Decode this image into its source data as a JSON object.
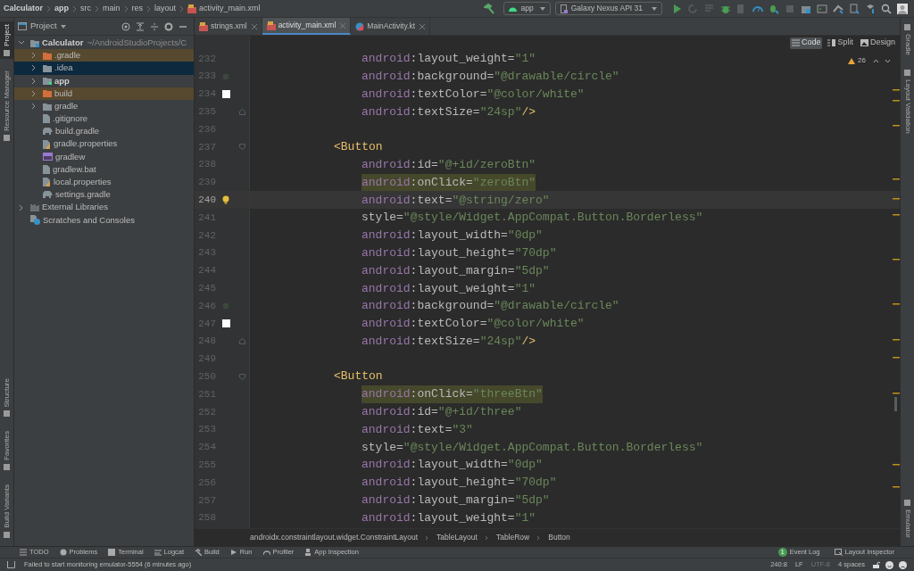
{
  "breadcrumb": [
    {
      "label": "Calculator",
      "bold": true
    },
    {
      "label": "app",
      "bold": true
    },
    {
      "label": "src",
      "bold": false
    },
    {
      "label": "main",
      "bold": false
    },
    {
      "label": "res",
      "bold": false
    },
    {
      "label": "layout",
      "bold": false
    },
    {
      "label": "activity_main.xml",
      "bold": false,
      "kind": "xml"
    }
  ],
  "run_config": {
    "module": "app",
    "device": "Galaxy Nexus API 31"
  },
  "left_stripe": {
    "top": [
      {
        "label": "Project",
        "selected": true
      },
      {
        "label": "Resource Manager",
        "selected": false
      }
    ],
    "bottom": [
      {
        "label": "Structure",
        "selected": false
      },
      {
        "label": "Favorites",
        "selected": false
      },
      {
        "label": "Build Variants",
        "selected": false
      }
    ]
  },
  "right_stripe": {
    "top": [
      {
        "label": "Gradle"
      },
      {
        "label": "Layout Validation"
      }
    ],
    "bottom": [
      {
        "label": "Emulator"
      }
    ]
  },
  "project_panel": {
    "title": "Project",
    "tree": [
      {
        "label": "Calculator",
        "path": "~/AndroidStudioProjects/C",
        "kind": "module-root",
        "expanded": true,
        "selected": false,
        "excluded": false,
        "bold": true,
        "children": [
          {
            "label": ".gradle",
            "kind": "folder",
            "expanded": false,
            "selected": false,
            "excluded": true,
            "bold": false
          },
          {
            "label": ".idea",
            "kind": "folder",
            "expanded": false,
            "selected": true,
            "excluded": false,
            "bold": false
          },
          {
            "label": "app",
            "kind": "module",
            "expanded": false,
            "selected": false,
            "excluded": false,
            "bold": true
          },
          {
            "label": "build",
            "kind": "folder",
            "expanded": false,
            "selected": false,
            "excluded": true,
            "bold": false
          },
          {
            "label": "gradle",
            "kind": "folder",
            "expanded": false,
            "selected": false,
            "excluded": false,
            "bold": false
          },
          {
            "label": ".gitignore",
            "kind": "file",
            "selected": false,
            "excluded": false,
            "bold": false
          },
          {
            "label": "build.gradle",
            "kind": "gradle",
            "selected": false,
            "excluded": false,
            "bold": false
          },
          {
            "label": "gradle.properties",
            "kind": "properties",
            "selected": false,
            "excluded": false,
            "bold": false
          },
          {
            "label": "gradlew",
            "kind": "script",
            "selected": false,
            "excluded": false,
            "bold": false
          },
          {
            "label": "gradlew.bat",
            "kind": "file",
            "selected": false,
            "excluded": false,
            "bold": false
          },
          {
            "label": "local.properties",
            "kind": "properties",
            "selected": false,
            "excluded": false,
            "bold": false
          },
          {
            "label": "settings.gradle",
            "kind": "gradle",
            "selected": false,
            "excluded": false,
            "bold": false
          }
        ]
      },
      {
        "label": "External Libraries",
        "kind": "library",
        "expanded": false,
        "selected": false,
        "excluded": false,
        "bold": false
      },
      {
        "label": "Scratches and Consoles",
        "kind": "scratches",
        "selected": false,
        "excluded": false,
        "bold": false
      }
    ]
  },
  "tabs": [
    {
      "label": "strings.xml",
      "kind": "xml",
      "selected": false
    },
    {
      "label": "activity_main.xml",
      "kind": "xml",
      "selected": true
    },
    {
      "label": "MainActivity.kt",
      "kind": "kotlin",
      "selected": false
    }
  ],
  "view_modes": [
    {
      "label": "Code",
      "kind": "code",
      "selected": true
    },
    {
      "label": "Split",
      "kind": "split",
      "selected": false
    },
    {
      "label": "Design",
      "kind": "design",
      "selected": false
    }
  ],
  "warnings": "26",
  "code_lines": [
    {
      "number": "232",
      "kind": "attribute",
      "text": "android:layout_weight=\"1\"",
      "current": false,
      "highlighted": false
    },
    {
      "number": "233",
      "kind": "attribute",
      "text": "android:background=\"@drawable/circle\"",
      "current": false,
      "highlighted": false,
      "gutter": {
        "kind": "drawable"
      }
    },
    {
      "number": "234",
      "kind": "attribute",
      "text": "android:textColor=\"@color/white\"",
      "current": false,
      "highlighted": false,
      "gutter": {
        "kind": "color"
      }
    },
    {
      "number": "235",
      "kind": "attribute",
      "text": "android:textSize=\"24sp\"/>",
      "current": false,
      "highlighted": false,
      "fold": {
        "kind": "end"
      }
    },
    {
      "number": "236",
      "kind": "blank",
      "current": false,
      "highlighted": false
    },
    {
      "number": "237",
      "kind": "tag",
      "text": "<Button",
      "current": false,
      "highlighted": false,
      "fold": {
        "kind": "start"
      }
    },
    {
      "number": "238",
      "kind": "attribute",
      "text": "android:id=\"@+id/zeroBtn\"",
      "current": false,
      "highlighted": false
    },
    {
      "number": "239",
      "kind": "attribute",
      "text": "android:onClick=\"zeroBtn\"",
      "current": false,
      "highlighted": true
    },
    {
      "number": "240",
      "kind": "attribute",
      "text": "android:text=\"@string/zero\"",
      "current": true,
      "highlighted": false,
      "gutter": {
        "kind": "bulb"
      }
    },
    {
      "number": "241",
      "kind": "attribute",
      "text": "style=\"@style/Widget.AppCompat.Button.Borderless\"",
      "current": false,
      "highlighted": false
    },
    {
      "number": "242",
      "kind": "attribute",
      "text": "android:layout_width=\"0dp\"",
      "current": false,
      "highlighted": false
    },
    {
      "number": "243",
      "kind": "attribute",
      "text": "android:layout_height=\"70dp\"",
      "current": false,
      "highlighted": false
    },
    {
      "number": "244",
      "kind": "attribute",
      "text": "android:layout_margin=\"5dp\"",
      "current": false,
      "highlighted": false
    },
    {
      "number": "245",
      "kind": "attribute",
      "text": "android:layout_weight=\"1\"",
      "current": false,
      "highlighted": false
    },
    {
      "number": "246",
      "kind": "attribute",
      "text": "android:background=\"@drawable/circle\"",
      "current": false,
      "highlighted": false,
      "gutter": {
        "kind": "drawable"
      }
    },
    {
      "number": "247",
      "kind": "attribute",
      "text": "android:textColor=\"@color/white\"",
      "current": false,
      "highlighted": false,
      "gutter": {
        "kind": "color"
      }
    },
    {
      "number": "248",
      "kind": "attribute",
      "text": "android:textSize=\"24sp\"/>",
      "current": false,
      "highlighted": false,
      "fold": {
        "kind": "end"
      }
    },
    {
      "number": "249",
      "kind": "blank",
      "current": false,
      "highlighted": false
    },
    {
      "number": "250",
      "kind": "tag",
      "text": "<Button",
      "current": false,
      "highlighted": false,
      "fold": {
        "kind": "start"
      }
    },
    {
      "number": "251",
      "kind": "attribute",
      "text": "android:onClick=\"threeBtn\"",
      "current": false,
      "highlighted": true
    },
    {
      "number": "252",
      "kind": "attribute",
      "text": "android:id=\"@+id/three\"",
      "current": false,
      "highlighted": false
    },
    {
      "number": "253",
      "kind": "attribute",
      "text": "android:text=\"3\"",
      "current": false,
      "highlighted": false
    },
    {
      "number": "254",
      "kind": "attribute",
      "text": "style=\"@style/Widget.AppCompat.Button.Borderless\"",
      "current": false,
      "highlighted": false
    },
    {
      "number": "255",
      "kind": "attribute",
      "text": "android:layout_width=\"0dp\"",
      "current": false,
      "highlighted": false
    },
    {
      "number": "256",
      "kind": "attribute",
      "text": "android:layout_height=\"70dp\"",
      "current": false,
      "highlighted": false
    },
    {
      "number": "257",
      "kind": "attribute",
      "text": "android:layout_margin=\"5dp\"",
      "current": false,
      "highlighted": false
    },
    {
      "number": "258",
      "kind": "attribute",
      "text": "android:layout_weight=\"1\"",
      "current": false,
      "highlighted": false
    }
  ],
  "xml_path": [
    "androidx.constraintlayout.widget.ConstraintLayout",
    "TableLayout",
    "TableRow",
    "Button"
  ],
  "tool_windows": [
    {
      "label": "TODO",
      "kind": "list"
    },
    {
      "label": "Problems",
      "kind": "problems"
    },
    {
      "label": "Terminal",
      "kind": "terminal"
    },
    {
      "label": "Logcat",
      "kind": "logcat"
    },
    {
      "label": "Build",
      "kind": "hammer"
    },
    {
      "label": "Run",
      "kind": "run"
    },
    {
      "label": "Profiler",
      "kind": "gauge"
    },
    {
      "label": "App Inspection",
      "kind": "inspect"
    }
  ],
  "tool_windows_right": [
    {
      "label": "Event Log",
      "badge": "1"
    },
    {
      "label": "Layout Inspector"
    }
  ],
  "status_bar": {
    "message": "Failed to start monitoring emulator-5554 (6 minutes ago)",
    "position": "240:8",
    "line_separator": "LF",
    "encoding": "UTF-8",
    "indent": "4 spaces"
  }
}
